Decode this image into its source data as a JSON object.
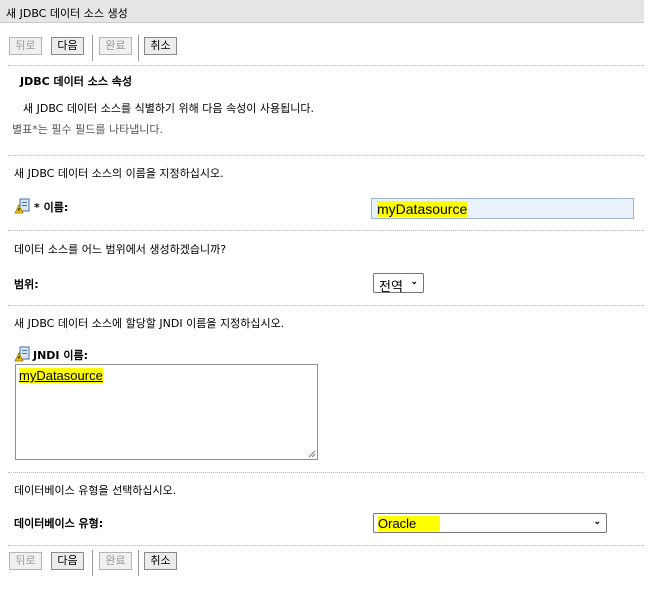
{
  "window": {
    "title": "새 JDBC 데이터 소스 생성"
  },
  "toolbar": {
    "back_label": "뒤로",
    "next_label": "다음",
    "finish_label": "완료",
    "cancel_label": "취소"
  },
  "section": {
    "heading": "JDBC 데이터 소스 속성",
    "intro": "새 JDBC 데이터 소스를 식별하기 위해 다음 속성이 사용됩니다.",
    "required_note": "별표*는 필수 필드를 나타냅니다."
  },
  "name_block": {
    "prompt": "새 JDBC 데이터 소스의 이름을 지정하십시오.",
    "label": "* 이름:",
    "value": "myDatasource"
  },
  "scope_block": {
    "prompt": "데이터 소스를 어느 범위에서 생성하겠습니까?",
    "label": "범위:",
    "selected": "전역"
  },
  "jndi_block": {
    "prompt": "새 JDBC 데이터 소스에 할당할 JNDI 이름을 지정하십시오.",
    "label": "JNDI 이름:",
    "value": "myDatasource"
  },
  "dbtype_block": {
    "prompt": "데이터베이스 유형을 선택하십시오.",
    "label": "데이터베이스 유형:",
    "selected": "Oracle"
  },
  "icons": {
    "help": "help-warning-icon",
    "dropdown": "chevron-down-icon",
    "resize": "resize-grip-icon"
  },
  "colors": {
    "highlight": "#ffff00",
    "input_bg": "#e9f2fb",
    "titlebar_bg": "#e6e6e6"
  }
}
